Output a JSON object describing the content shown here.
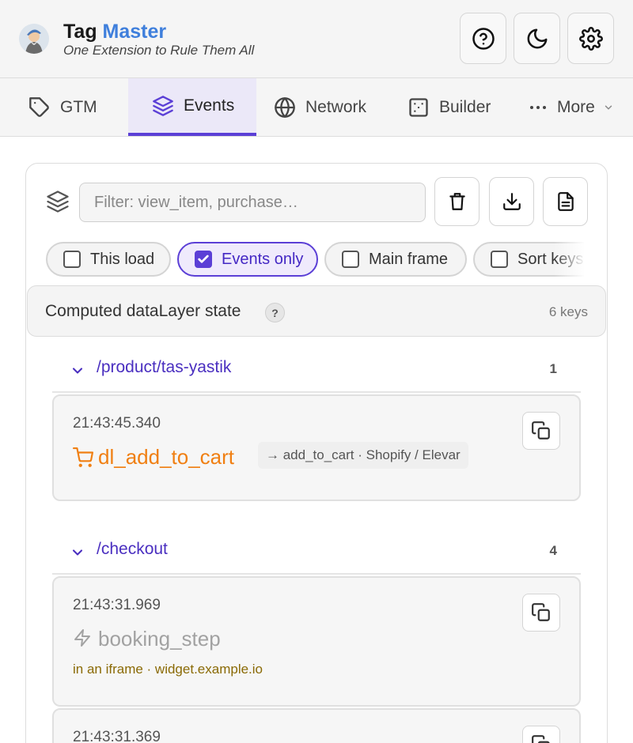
{
  "header": {
    "app_name_part1": "Tag",
    "app_name_part2": "Master",
    "tagline": "One Extension to Rule Them All",
    "help_icon": "help-circle-icon",
    "theme_icon": "moon-icon",
    "settings_icon": "gear-icon"
  },
  "tabs": [
    {
      "label": "GTM",
      "icon": "tag-icon"
    },
    {
      "label": "Events",
      "icon": "layers-icon",
      "active": true
    },
    {
      "label": "Network",
      "icon": "globe-icon"
    },
    {
      "label": "Builder",
      "icon": "builder-icon"
    },
    {
      "label": "More",
      "icon": "ellipsis-icon"
    }
  ],
  "filter": {
    "placeholder": "Filter: view_item, purchase…"
  },
  "toggles": [
    {
      "label": "This load",
      "checked": false
    },
    {
      "label": "Events only",
      "checked": true
    },
    {
      "label": "Main frame",
      "checked": false
    },
    {
      "label": "Sort keys",
      "checked": false
    }
  ],
  "state_bar": {
    "title": "Computed dataLayer state",
    "help": "?",
    "keys": "6 keys"
  },
  "groups": [
    {
      "path": "/product/tas-yastik",
      "count": "1",
      "events": [
        {
          "time": "21:43:45.340",
          "name": "dl_add_to_cart",
          "meta": "→ add_to_cart · Shopify / Elevar"
        }
      ]
    },
    {
      "path": "/checkout",
      "count": "4",
      "events": [
        {
          "time": "21:43:31.969",
          "name": "booking_step",
          "note": "in an iframe · widget.example.io"
        },
        {
          "time": "21:43:31.369"
        }
      ]
    }
  ],
  "colors": {
    "accent": "#5b3fd6",
    "brand_blue": "#3f7fdc",
    "event_orange": "#f07f12",
    "iframe_note": "#8a6a05"
  }
}
